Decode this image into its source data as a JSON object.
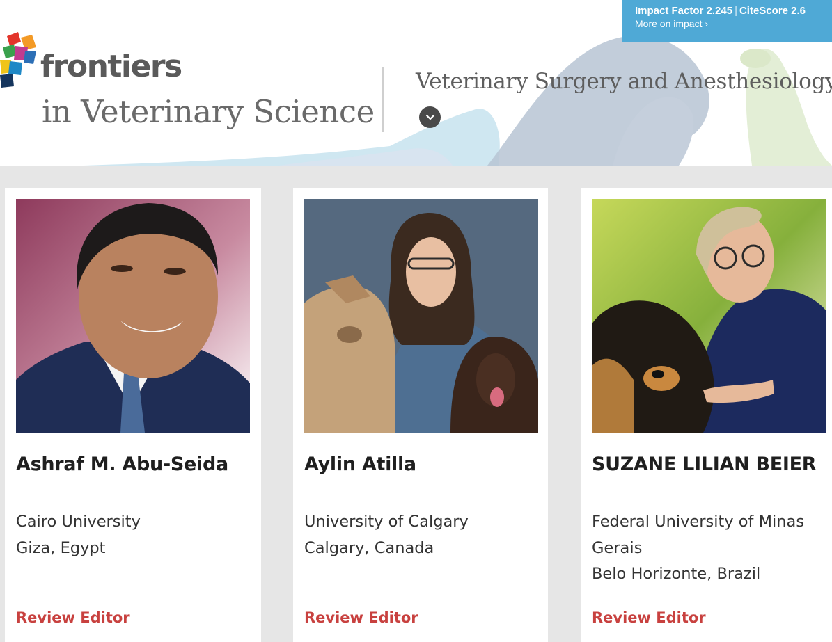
{
  "header": {
    "brand": "frontiers",
    "journal": "in Veterinary Science",
    "section_title": "Veterinary Surgery and Anesthesiology",
    "impact": {
      "impact_factor": "Impact Factor 2.245",
      "separator": "|",
      "citescore": "CiteScore 2.6",
      "more_link": "More on impact ›"
    }
  },
  "editors": [
    {
      "name": "Ashraf M. Abu-Seida",
      "affiliation_lines": [
        "Cairo University",
        "Giza, Egypt"
      ],
      "role": "Review Editor"
    },
    {
      "name": "Aylin Atilla",
      "affiliation_lines": [
        "University of Calgary",
        "Calgary, Canada"
      ],
      "role": "Review Editor"
    },
    {
      "name": "SUZANE LILIAN BEIER",
      "affiliation_lines": [
        "Federal University of Minas",
        "Gerais",
        "Belo Horizonte, Brazil"
      ],
      "role": "Review Editor"
    }
  ],
  "colors": {
    "impact_banner": "#4fa9d6",
    "role_link": "#c8413f",
    "page_background": "#e6e6e6"
  },
  "icons": {
    "section_toggle": "chevron-down-icon",
    "logo": "frontiers-logo-icon"
  }
}
